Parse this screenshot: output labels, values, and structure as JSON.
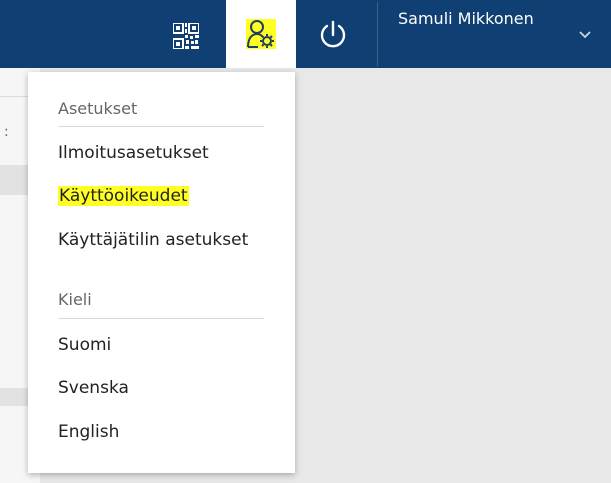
{
  "header": {
    "user_name": "Samuli Mikkonen",
    "icons": {
      "qr": "qr-code-icon",
      "settings": "user-settings-icon",
      "power": "power-icon",
      "chevron": "chevron-down-icon"
    }
  },
  "dropdown": {
    "settings_section_title": "Asetukset",
    "settings_items": [
      "Ilmoitusasetukset",
      "Käyttöoikeudet",
      "Käyttäjätilin asetukset"
    ],
    "language_section_title": "Kieli",
    "language_items": [
      "Suomi",
      "Svenska",
      "English"
    ]
  },
  "page": {
    "edge_text": ":"
  },
  "colors": {
    "nav_bg": "#0f3f73",
    "highlight": "#ffff24"
  }
}
